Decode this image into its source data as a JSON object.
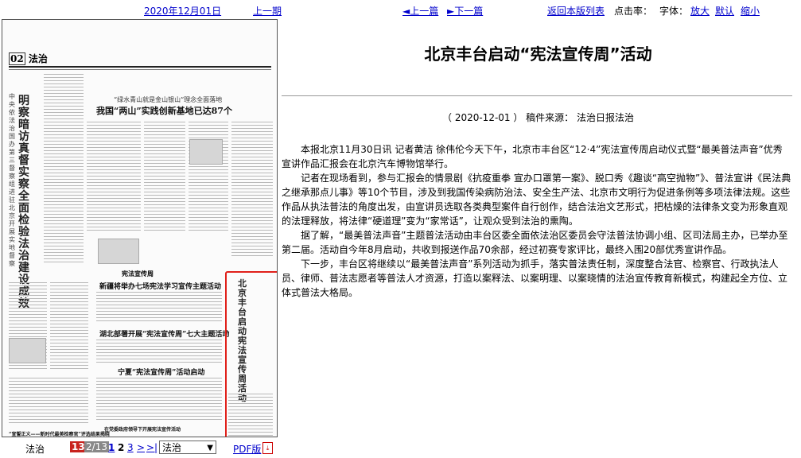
{
  "nav": {
    "date": "2020年12月01日",
    "prev_day": "上一期",
    "prev_article": "◄上一篇",
    "next_article": "►下一篇",
    "back_to_list": "返回本版列表",
    "click_rate_label": "点击率：",
    "font_label": "字体：",
    "font_large": "放大",
    "font_default": "默认",
    "font_small": "缩小"
  },
  "page_thumb": {
    "page_number": "02",
    "section": "法治",
    "vertical_headline": "明察暗访真督实察全面检验法治建设成效",
    "vertical_subline": "中央依法治国办第三督察组进驻北京开展实地督察",
    "headline_main": "我国“两山”实践创新基地已达87个",
    "headline_kicker": "“绿水青山就是金山银山”理念全面落地",
    "headline_2": "新疆将举办七场宪法学习宣传主题活动",
    "headline_3": "湖北部署开展“宪法宣传周”七大主题活动",
    "headline_4": "宁夏“宪法宣传周”活动启动",
    "headline_5": "“宣誓正义——新时代最美检察官”评选结果揭晓",
    "headline_6": "在党委政府领导下开展宪法宣传活动",
    "column_tag": "宪法宣传周",
    "highlight_title": "北京丰台启动宪法宣传周活动"
  },
  "pager": {
    "section": "法治",
    "current_page": "13",
    "total_pages": "2/13",
    "page_links": [
      "1",
      "2",
      "3",
      ">",
      ">|"
    ],
    "select_value": "法治",
    "pdf_label": "PDF版",
    "pdf_icon": "pdf-icon"
  },
  "article": {
    "title": "北京丰台启动“宪法宣传周”活动",
    "meta": "（ 2020-12-01 ） 稿件来源： 法治日报法治",
    "paragraphs": [
      "本报北京11月30日讯 记者黄洁 徐伟伦今天下午，北京市丰台区“12·4”宪法宣传周启动仪式暨“最美普法声音”优秀宣讲作品汇报会在北京汽车博物馆举行。",
      "记者在现场看到，参与汇报会的情景剧《抗疫重拳 宣办口罩第一案》、脱口秀《趣谈“高空抛物”》、普法宣讲《民法典之继承那点儿事》等10个节目，涉及到我国传染病防治法、安全生产法、北京市文明行为促进条例等多项法律法规。这些作品从执法普法的角度出发，由宣讲员选取各类典型案件自行创作，结合法治文艺形式，把枯燥的法律条文变为形象直观的法理释放，将法律“硬道理”变为“家常话”，让观众受到法治的熏陶。",
      "据了解，“最美普法声音”主题普法活动由丰台区委全面依法治区委员会守法普法协调小组、区司法局主办，已举办至第二届。活动自今年8月启动，共收到报送作品70余部，经过初赛专家评比，最终入围20部优秀宣讲作品。",
      "下一步，丰台区将继续以“最美普法声音”系列活动为抓手，落实普法责任制，深度整合法官、检察官、行政执法人员、律师、普法志愿者等普法人才资源，打造以案释法、以案明理、以案晓情的法治宣传教育新模式，构建起全方位、立体式普法大格局。"
    ]
  },
  "colors": {
    "link": "#0000cc",
    "highlight_border": "#e0201a",
    "current_page_bg": "#c8221d"
  }
}
